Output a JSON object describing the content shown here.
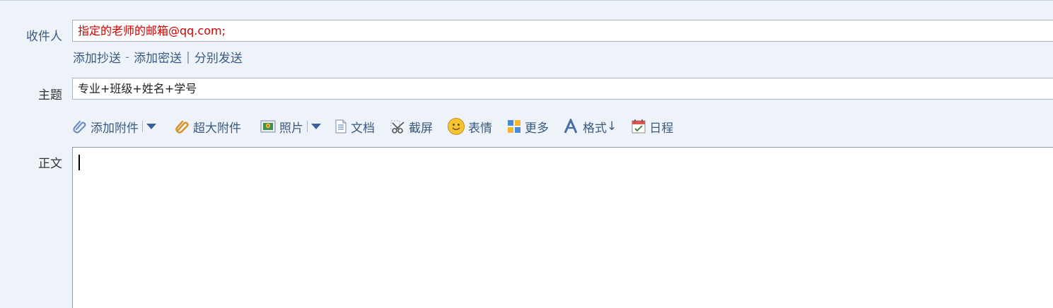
{
  "recipient": {
    "label": "收件人",
    "value": "指定的老师的邮箱@qq.com;"
  },
  "recipient_links": {
    "add_cc": "添加抄送",
    "dash": "-",
    "add_bcc": "添加密送",
    "pipe": "|",
    "send_separately": "分别发送"
  },
  "subject": {
    "label": "主题",
    "value": "专业+班级+姓名+学号"
  },
  "toolbar": {
    "add_attachment": "添加附件",
    "large_attachment": "超大附件",
    "photo": "照片",
    "document": "文档",
    "screenshot": "截屏",
    "emoji": "表情",
    "more": "更多",
    "format": "格式",
    "format_arrow": "↓",
    "schedule": "日程"
  },
  "body": {
    "label": "正文",
    "value": ""
  },
  "colors": {
    "background": "#eef3fa",
    "link": "#3b5a80",
    "recipient_text": "#d40000"
  },
  "icons": [
    "paperclip-icon",
    "dropdown-caret-icon",
    "large-paperclip-icon",
    "photo-icon",
    "document-icon",
    "scissors-icon",
    "smiley-icon",
    "grid-icon",
    "font-a-icon",
    "calendar-icon"
  ]
}
